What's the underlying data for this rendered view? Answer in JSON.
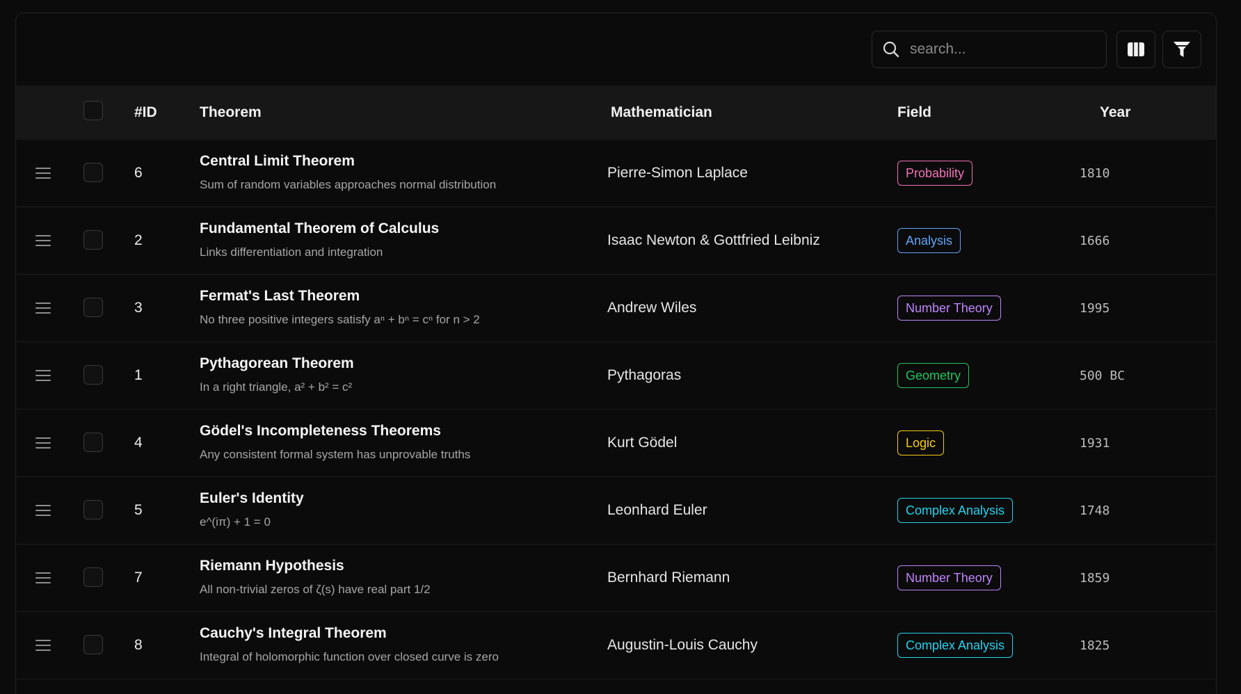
{
  "toolbar": {
    "search_placeholder": "search...",
    "columns_icon": "columns-icon",
    "filter_icon": "filter-icon"
  },
  "header": {
    "id": "#ID",
    "theorem": "Theorem",
    "mathematician": "Mathematician",
    "field": "Field",
    "year": "Year"
  },
  "colors": {
    "Probability": "#f472b6",
    "Analysis": "#60a5fa",
    "Number Theory": "#c084fc",
    "Geometry": "#22c55e",
    "Logic": "#facc15",
    "Complex Analysis": "#22d3ee"
  },
  "rows": [
    {
      "id": "6",
      "title": "Central Limit Theorem",
      "desc": "Sum of random variables approaches normal distribution",
      "mathematician": "Pierre-Simon Laplace",
      "field": "Probability",
      "year": "1810"
    },
    {
      "id": "2",
      "title": "Fundamental Theorem of Calculus",
      "desc": "Links differentiation and integration",
      "mathematician": "Isaac Newton & Gottfried Leibniz",
      "field": "Analysis",
      "year": "1666"
    },
    {
      "id": "3",
      "title": "Fermat's Last Theorem",
      "desc": "No three positive integers satisfy aⁿ + bⁿ = cⁿ for n > 2",
      "mathematician": "Andrew Wiles",
      "field": "Number Theory",
      "year": "1995"
    },
    {
      "id": "1",
      "title": "Pythagorean Theorem",
      "desc": "In a right triangle, a² + b² = c²",
      "mathematician": "Pythagoras",
      "field": "Geometry",
      "year": "500 BC"
    },
    {
      "id": "4",
      "title": "Gödel's Incompleteness Theorems",
      "desc": "Any consistent formal system has unprovable truths",
      "mathematician": "Kurt Gödel",
      "field": "Logic",
      "year": "1931"
    },
    {
      "id": "5",
      "title": "Euler's Identity",
      "desc": "e^(iπ) + 1 = 0",
      "mathematician": "Leonhard Euler",
      "field": "Complex Analysis",
      "year": "1748"
    },
    {
      "id": "7",
      "title": "Riemann Hypothesis",
      "desc": "All non-trivial zeros of ζ(s) have real part 1/2",
      "mathematician": "Bernhard Riemann",
      "field": "Number Theory",
      "year": "1859"
    },
    {
      "id": "8",
      "title": "Cauchy's Integral Theorem",
      "desc": "Integral of holomorphic function over closed curve is zero",
      "mathematician": "Augustin-Louis Cauchy",
      "field": "Complex Analysis",
      "year": "1825"
    }
  ]
}
